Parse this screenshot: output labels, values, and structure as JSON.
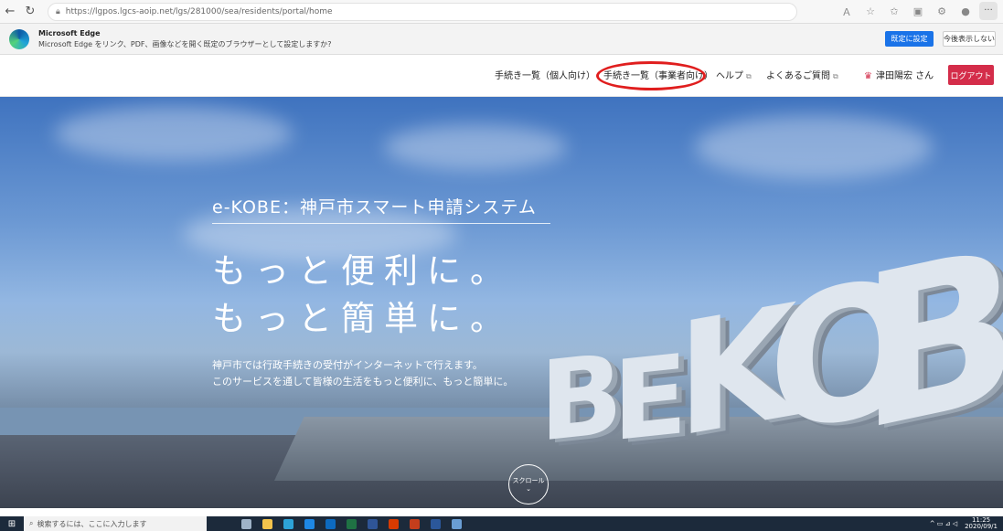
{
  "browser": {
    "back_icon": "←",
    "refresh_icon": "↻",
    "url": "https://lgpos.lgcs-aoip.net/lgs/281000/sea/residents/portal/home",
    "right_icons": [
      "read-aloud",
      "favorites-add",
      "favorites",
      "collections",
      "extensions",
      "profile"
    ],
    "more_label": "···"
  },
  "infobar": {
    "title": "Microsoft Edge",
    "message": "Microsoft Edge をリンク、PDF、画像などを開く既定のブラウザーとして設定しますか?",
    "primary_label": "既定に設定",
    "secondary_label": "今後表示しない"
  },
  "header": {
    "nav": [
      {
        "label": "手続き一覧（個人向け）",
        "ext": false
      },
      {
        "label": "手続き一覧（事業者向け）",
        "ext": false
      },
      {
        "label": "ヘルプ",
        "ext": true
      },
      {
        "label": "よくあるご質問",
        "ext": true
      }
    ],
    "user_name": "津田陽宏 さん",
    "logout_label": "ログアウト"
  },
  "hero": {
    "title": "e-KOBE：神戸市スマート申請システム",
    "catch_1": "もっと便利に。",
    "catch_2": "もっと簡単に。",
    "desc_1": "神戸市では行政手続きの受付がインターネットで行えます。",
    "desc_2": "このサービスを通して皆様の生活をもっと便利に、もっと簡単に。",
    "kobe_letters": "BE KOBE",
    "scroll_label": "スクロール",
    "scroll_icon": "⌄"
  },
  "taskbar": {
    "search_placeholder": "検索するには、ここに入力します",
    "time": "11:25",
    "date": "2020/09/1"
  },
  "colors": {
    "highlight": "#e01e1e",
    "logout": "#d42d4a",
    "edge_primary": "#1a73e8"
  }
}
